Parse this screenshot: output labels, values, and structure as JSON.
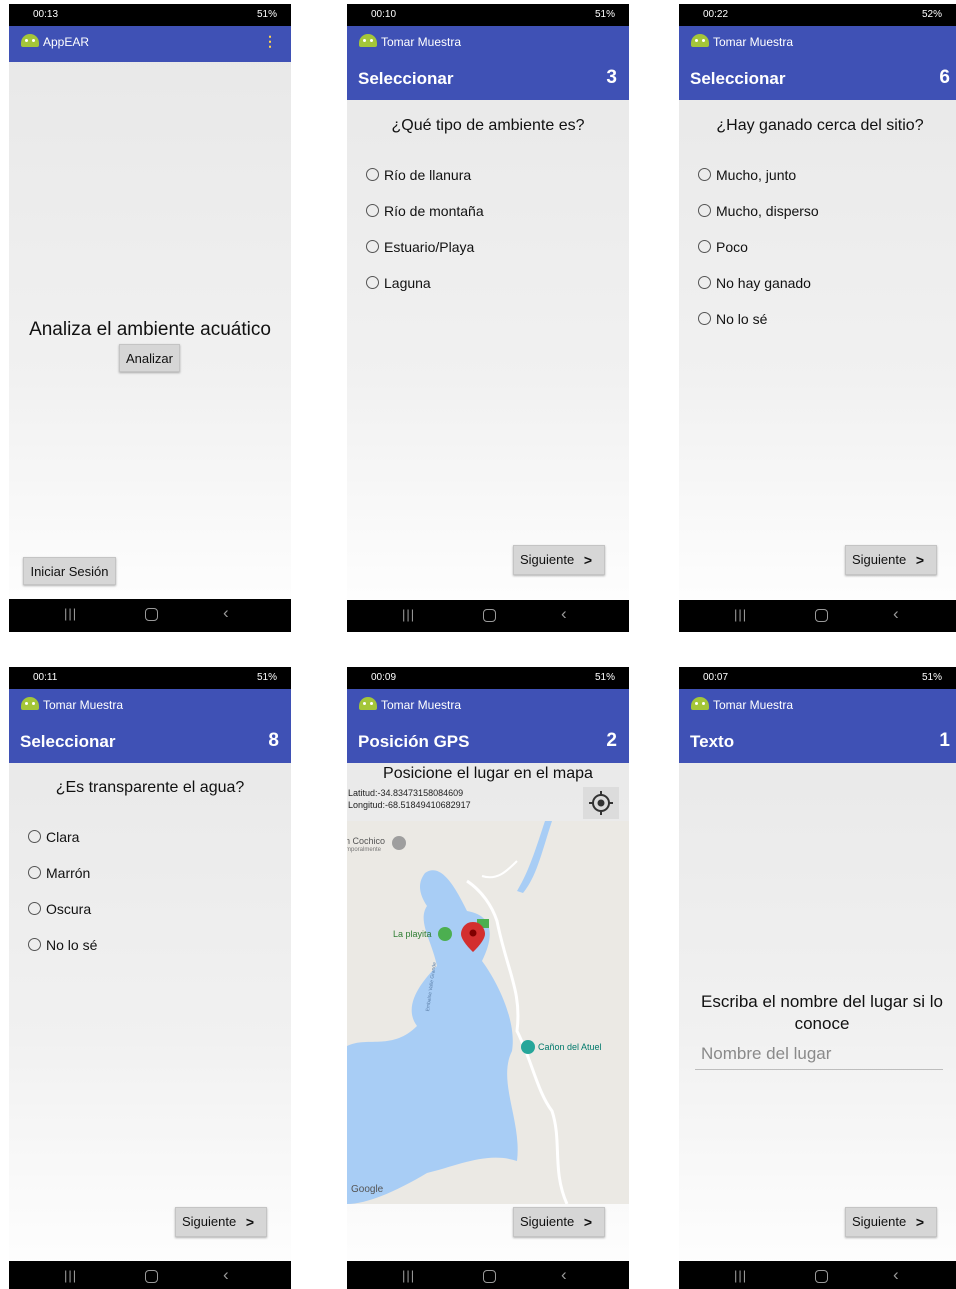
{
  "colors": {
    "primary": "#3f51b5",
    "marker": "#d32f2f",
    "water": "#a8cdf5"
  },
  "screens": {
    "s1": {
      "time": "00:13",
      "signal": "51%",
      "app_title": "AppEAR",
      "heading": "Analiza el ambiente acuático",
      "analyze_button": "Analizar",
      "login_button": "Iniciar Sesión"
    },
    "s2": {
      "time": "00:10",
      "signal": "51%",
      "app_title": "Tomar Muestra",
      "section_title": "Seleccionar",
      "section_number": "3",
      "question": "¿Qué tipo de ambiente es?",
      "options": [
        "Río de llanura",
        "Río de montaña",
        "Estuario/Playa",
        "Laguna"
      ],
      "next_button": "Siguiente"
    },
    "s3": {
      "time": "00:22",
      "signal": "52%",
      "app_title": "Tomar Muestra",
      "section_title": "Seleccionar",
      "section_number": "6",
      "question": "¿Hay ganado cerca del sitio?",
      "options": [
        "Mucho, junto",
        "Mucho, disperso",
        "Poco",
        "No hay ganado",
        "No lo sé"
      ],
      "next_button": "Siguiente"
    },
    "s4": {
      "time": "00:11",
      "signal": "51%",
      "app_title": "Tomar Muestra",
      "section_title": "Seleccionar",
      "section_number": "8",
      "question": "¿Es transparente el agua?",
      "options": [
        "Clara",
        "Marrón",
        "Oscura",
        "No lo sé"
      ],
      "next_button": "Siguiente"
    },
    "s5": {
      "time": "00:09",
      "signal": "51%",
      "app_title": "Tomar Muestra",
      "section_title": "Posición GPS",
      "section_number": "2",
      "instruction": "Posicione el lugar en el mapa",
      "latitude": "Latitud:-34.83473158084609",
      "longitude": "Longitud:-68.51849410682917",
      "map_labels": {
        "place1": "n Cochico",
        "place1_sub": "mporalmente",
        "place2": "La playita",
        "place3": "Cañon del Atuel",
        "place4": "Embalse Valle Grande",
        "google": "Google"
      },
      "next_button": "Siguiente"
    },
    "s6": {
      "time": "00:07",
      "signal": "51%",
      "app_title": "Tomar Muestra",
      "section_title": "Texto",
      "section_number": "1",
      "prompt": "Escriba el nombre del lugar si lo conoce",
      "input_placeholder": "Nombre del lugar",
      "next_button": "Siguiente"
    }
  }
}
